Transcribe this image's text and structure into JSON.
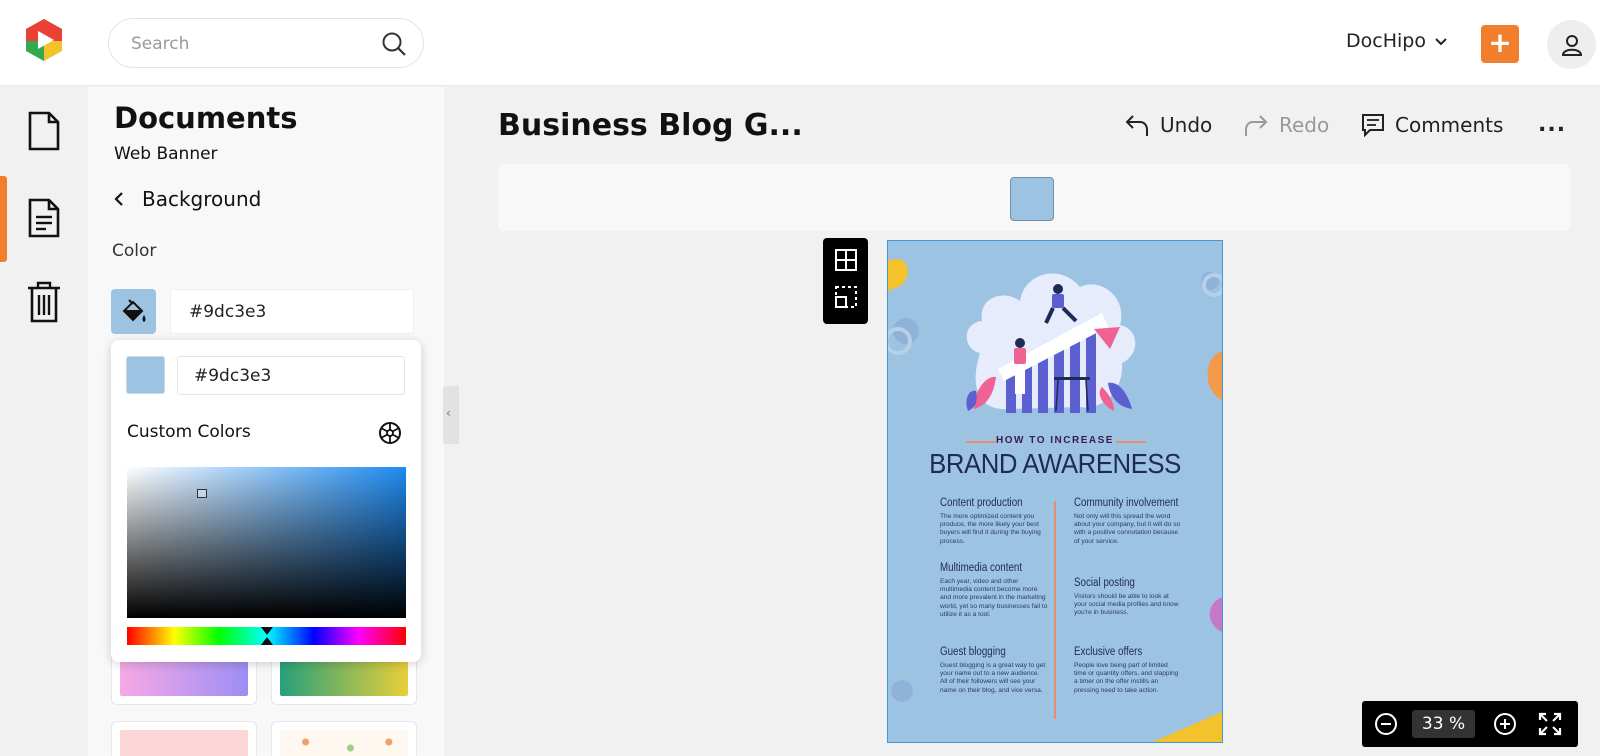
{
  "header": {
    "search_placeholder": "Search",
    "account_name": "DocHipo",
    "add_label": "+"
  },
  "rail": {
    "items": [
      {
        "icon": "document-icon"
      },
      {
        "icon": "document-lines-icon",
        "active": true
      },
      {
        "icon": "trash-icon"
      }
    ]
  },
  "panel": {
    "title": "Documents",
    "subtitle": "Web Banner",
    "back_label": "Background",
    "color_label": "Color",
    "hex_value": "#9dc3e3"
  },
  "picker": {
    "hex_value": "#9dc3e3",
    "custom_colors_label": "Custom Colors"
  },
  "editor": {
    "doc_title": "Business Blog G...",
    "undo_label": "Undo",
    "redo_label": "Redo",
    "comments_label": "Comments",
    "more_label": "..."
  },
  "poster": {
    "kicker": "HOW TO INCREASE",
    "title": "BRAND AWARENESS",
    "sections": [
      {
        "heading": "Content production",
        "body": "The more optimized content you produce, the more likely your best buyers will find it during the buying process."
      },
      {
        "heading": "Community involvement",
        "body": "Not only will this spread the word about your company, but it will do so with a positive connotation because of your service."
      },
      {
        "heading": "Multimedia content",
        "body": "Each year, video and other multimedia content become more and more prevalent in the marketing world, yet so many businesses fail to utilize it as a tool."
      },
      {
        "heading": "Social posting",
        "body": "Visitors should be able to look at your social media profiles and know you're in business."
      },
      {
        "heading": "Guest blogging",
        "body": "Guest blogging is a great way to get your name out to a new audience. All of their followers will see your name on their blog, and vice versa."
      },
      {
        "heading": "Exclusive offers",
        "body": "People love being part of limited time or quantity offers, and slapping a timer on the offer instills an pressing need to take action."
      }
    ]
  },
  "zoom": {
    "value": "33",
    "unit": "%"
  },
  "colors": {
    "accent": "#f07e2c",
    "background_selected": "#9dc3e3",
    "canvas_outline": "#3f98dd"
  }
}
